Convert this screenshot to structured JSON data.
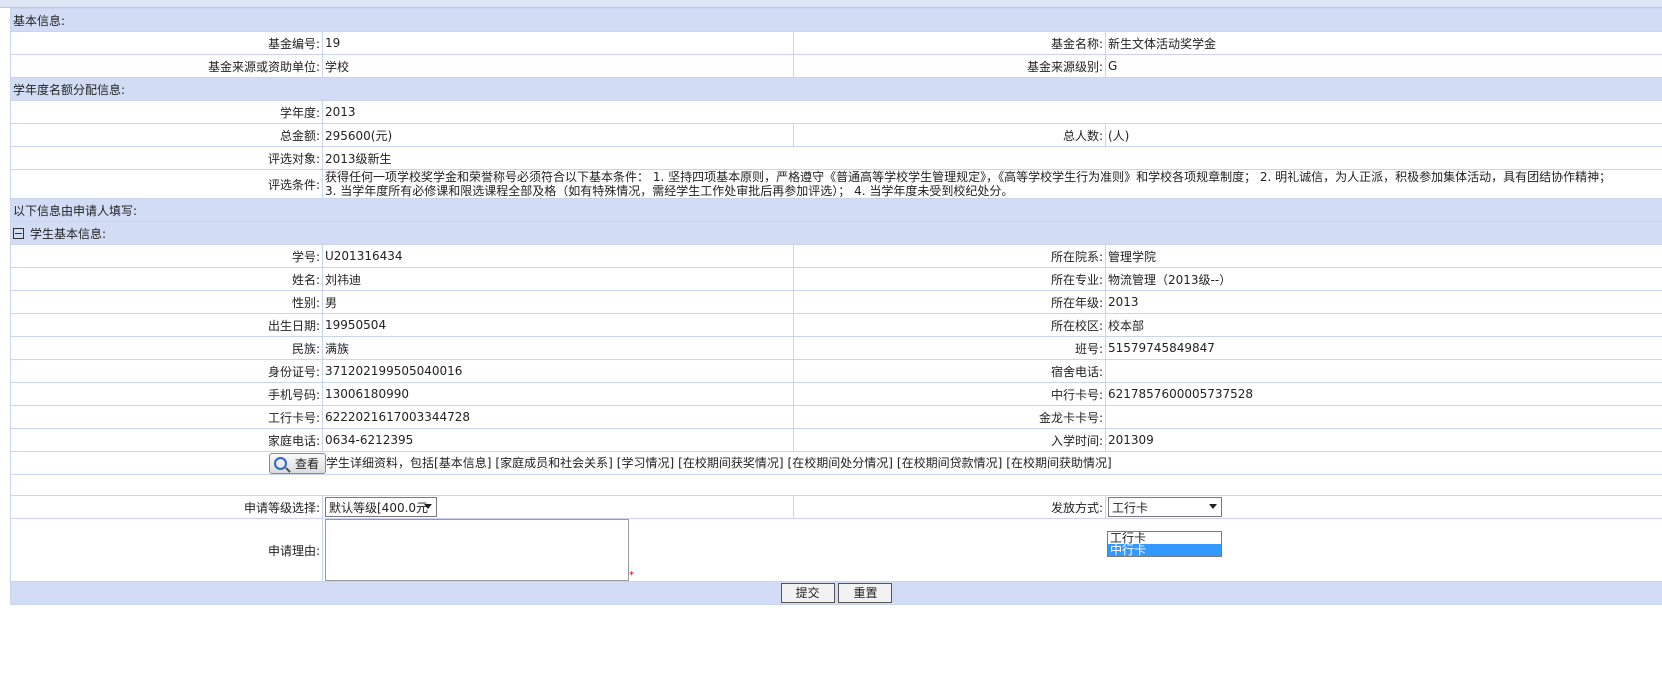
{
  "basic": {
    "title": "基本信息:",
    "fund_no_label": "基金编号:",
    "fund_no": "19",
    "fund_name_label": "基金名称:",
    "fund_name": "新生文体活动奖学金",
    "source_label": "基金来源或资助单位:",
    "source": "学校",
    "level_label": "基金来源级别:",
    "level": "G"
  },
  "quota": {
    "title": "学年度名额分配信息:",
    "year_label": "学年度:",
    "year": "2013",
    "total_label": "总金额:",
    "total": "295600(元)",
    "people_label": "总人数:",
    "people": "(人)",
    "target_label": "评选对象:",
    "target": "2013级新生",
    "criteria_label": "评选条件:",
    "criteria_line1": "获得任何一项学校奖学金和荣誉称号必须符合以下基本条件： 1. 坚持四项基本原则，严格遵守《普通高等学校学生管理规定》，《高等学校学生行为准则》和学校各项规章制度； 2. 明礼诚信，为人正派，积极参加集体活动，具有团结协作精神；",
    "criteria_line2": "3. 当学年度所有必修课和限选课程全部及格（如有特殊情况，需经学生工作处审批后再参加评选）； 4. 当学年度未受到校纪处分。"
  },
  "applicant": {
    "title": "以下信息由申请人填写:",
    "student_title": "学生基本信息:"
  },
  "student": {
    "sid_label": "学号:",
    "sid": "U201316434",
    "dept_label": "所在院系:",
    "dept": "管理学院",
    "name_label": "姓名:",
    "name": "刘祎迪",
    "major_label": "所在专业:",
    "major": "物流管理（2013级--）",
    "gender_label": "性别:",
    "gender": "男",
    "grade_label": "所在年级:",
    "grade": "2013",
    "birth_label": "出生日期:",
    "birth": "19950504",
    "campus_label": "所在校区:",
    "campus": "校本部",
    "ethnic_label": "民族:",
    "ethnic": "满族",
    "class_label": "班号:",
    "class_no": "51579745849847",
    "id_label": "身份证号:",
    "id_no": "371202199505040016",
    "dorm_label": "宿舍电话:",
    "dorm": "",
    "mobile_label": "手机号码:",
    "mobile": "13006180990",
    "boc_label": "中行卡号:",
    "boc": "6217857600005737528",
    "icbc_label": "工行卡号:",
    "icbc": "6222021617003344728",
    "jinlong_label": "金龙卡卡号:",
    "jinlong": "",
    "home_label": "家庭电话:",
    "home": "0634-6212395",
    "enroll_label": "入学时间:",
    "enroll": "201309"
  },
  "view": {
    "button_label": "查看",
    "desc": "学生详细资料，包括",
    "links": [
      "[基本信息]",
      "[家庭成员和社会关系]",
      "[学习情况]",
      "[在校期间获奖情况]",
      "[在校期间处分情况]",
      "[在校期间贷款情况]",
      "[在校期间获助情况]"
    ]
  },
  "apply": {
    "level_label": "申请等级选择:",
    "level_value": "默认等级[400.0元",
    "pay_label": "发放方式:",
    "pay_value": "工行卡",
    "pay_options": [
      "工行卡",
      "中行卡"
    ],
    "reason_label": "申请理由:",
    "reason_value": "",
    "required_mark": "*"
  },
  "footer": {
    "submit": "提交",
    "reset": "重置"
  },
  "icons": {
    "collapse": "collapse-minus-icon",
    "view": "magnifier-icon",
    "dropdown": "chevron-down-icon"
  }
}
